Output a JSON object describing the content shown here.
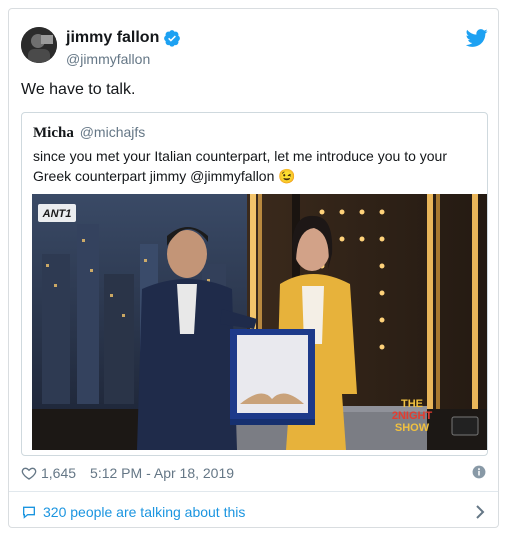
{
  "author": {
    "name": "jimmy fallon",
    "handle": "@jimmyfallon",
    "verified": true
  },
  "tweet": {
    "text": "We have to talk."
  },
  "quoted": {
    "name": "Micha",
    "handle": "@michajfs",
    "text": "since you met your Italian counterpart, let me introduce you to your Greek counterpart jimmy @jimmyfallon",
    "emoji": "😉",
    "media": {
      "channel_logo": "ANT1",
      "show_logo_line1": "THE",
      "show_logo_line2": "2NIGHT",
      "show_logo_line3": "SHOW"
    }
  },
  "meta": {
    "likes": "1,645",
    "timestamp": "5:12 PM - Apr 18, 2019"
  },
  "footer": {
    "talking": "320 people are talking about this"
  },
  "colors": {
    "brand": "#1da1f2",
    "link": "#1b95e0",
    "text": "#14171a",
    "secondary": "#657786",
    "border": "#d9dde0"
  },
  "icons": [
    "twitter-bird-icon",
    "verified-badge-icon",
    "heart-icon",
    "info-icon",
    "talk-bubble-icon",
    "chevron-right-icon"
  ]
}
